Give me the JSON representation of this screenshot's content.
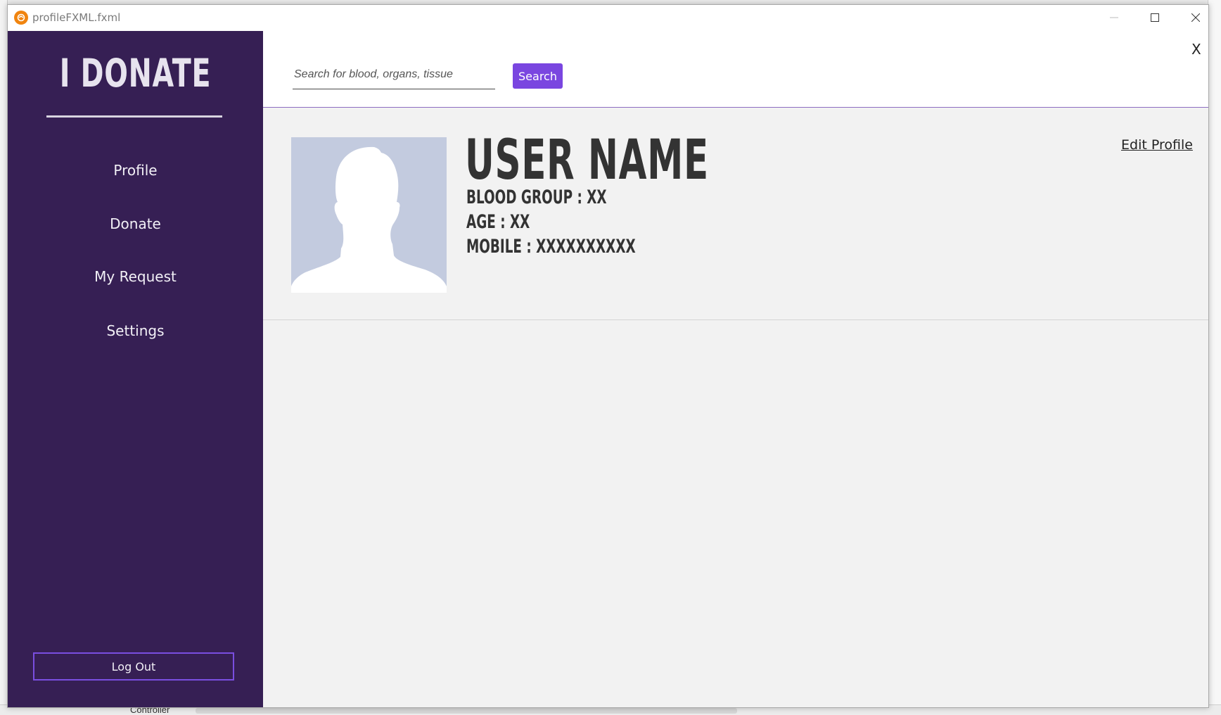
{
  "window": {
    "title": "profileFXML.fxml"
  },
  "background": {
    "controller_label": "Controller"
  },
  "sidebar": {
    "brand": "I DONATE",
    "items": [
      {
        "label": "Profile"
      },
      {
        "label": "Donate"
      },
      {
        "label": "My Request"
      },
      {
        "label": "Settings"
      }
    ],
    "logout_label": "Log Out"
  },
  "header": {
    "search_placeholder": "Search for blood, organs, tissue",
    "search_value": "",
    "search_button": "Search",
    "close_label": "X"
  },
  "profile": {
    "user_name": "USER NAME",
    "blood_group": "BLOOD GROUP : XX",
    "age": "AGE : XX",
    "mobile": "MOBILE : XXXXXXXXXX",
    "edit_label": "Edit Profile"
  },
  "colors": {
    "sidebar_bg": "#361f54",
    "accent": "#7a46e0",
    "content_bg": "#f2f2f2",
    "avatar_bg": "#c3cbdf"
  }
}
